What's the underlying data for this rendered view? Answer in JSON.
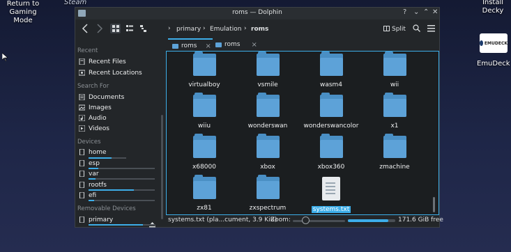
{
  "desktop": {
    "return_label": "Return to Gaming Mode",
    "steam_label": "Steam",
    "decky_label": "Install Decky",
    "emudeck_label": "EmuDeck",
    "emudeck_logo_text": "EMUDECK"
  },
  "window": {
    "title": "roms — Dolphin",
    "help_btn": "?",
    "min_btn": "⌄",
    "max_btn": "⌃",
    "close_btn": "✕"
  },
  "toolbar": {
    "breadcrumbs": [
      "primary",
      "Emulation",
      "roms"
    ],
    "split_label": "Split"
  },
  "sidebar": {
    "sections": [
      {
        "title": "Recent",
        "items": [
          "Recent Files",
          "Recent Locations"
        ]
      },
      {
        "title": "Search For",
        "items": [
          "Documents",
          "Images",
          "Audio",
          "Videos"
        ]
      },
      {
        "title": "Devices",
        "items": [
          "home",
          "esp",
          "var",
          "rootfs",
          "efi"
        ]
      },
      {
        "title": "Removable Devices",
        "items": [
          "primary"
        ]
      }
    ],
    "device_usage": {
      "home": 0.62,
      "esp": 0.15,
      "var": 0.1,
      "rootfs": 0.68,
      "efi": 0.08,
      "primary": 0.82
    }
  },
  "tabs": [
    {
      "label": "roms",
      "close": "×"
    },
    {
      "label": "roms",
      "close": "×"
    }
  ],
  "files": [
    "virtualboy",
    "vsmile",
    "wasm4",
    "wii",
    "wiiu",
    "wonderswan",
    "wonderswancolor",
    "x1",
    "x68000",
    "xbox",
    "xbox360",
    "zmachine",
    "zx81",
    "zxspectrum",
    "systems.txt"
  ],
  "status": {
    "selection_text": "systems.txt (pla...cument, 3.9 KiB)",
    "zoom_label": "Zoom:",
    "free_space": "171.6 GiB free",
    "free_fraction": 0.85
  },
  "colors": {
    "accent": "#3daee9",
    "folder": "#5da2d8",
    "window_bg": "#232629"
  }
}
